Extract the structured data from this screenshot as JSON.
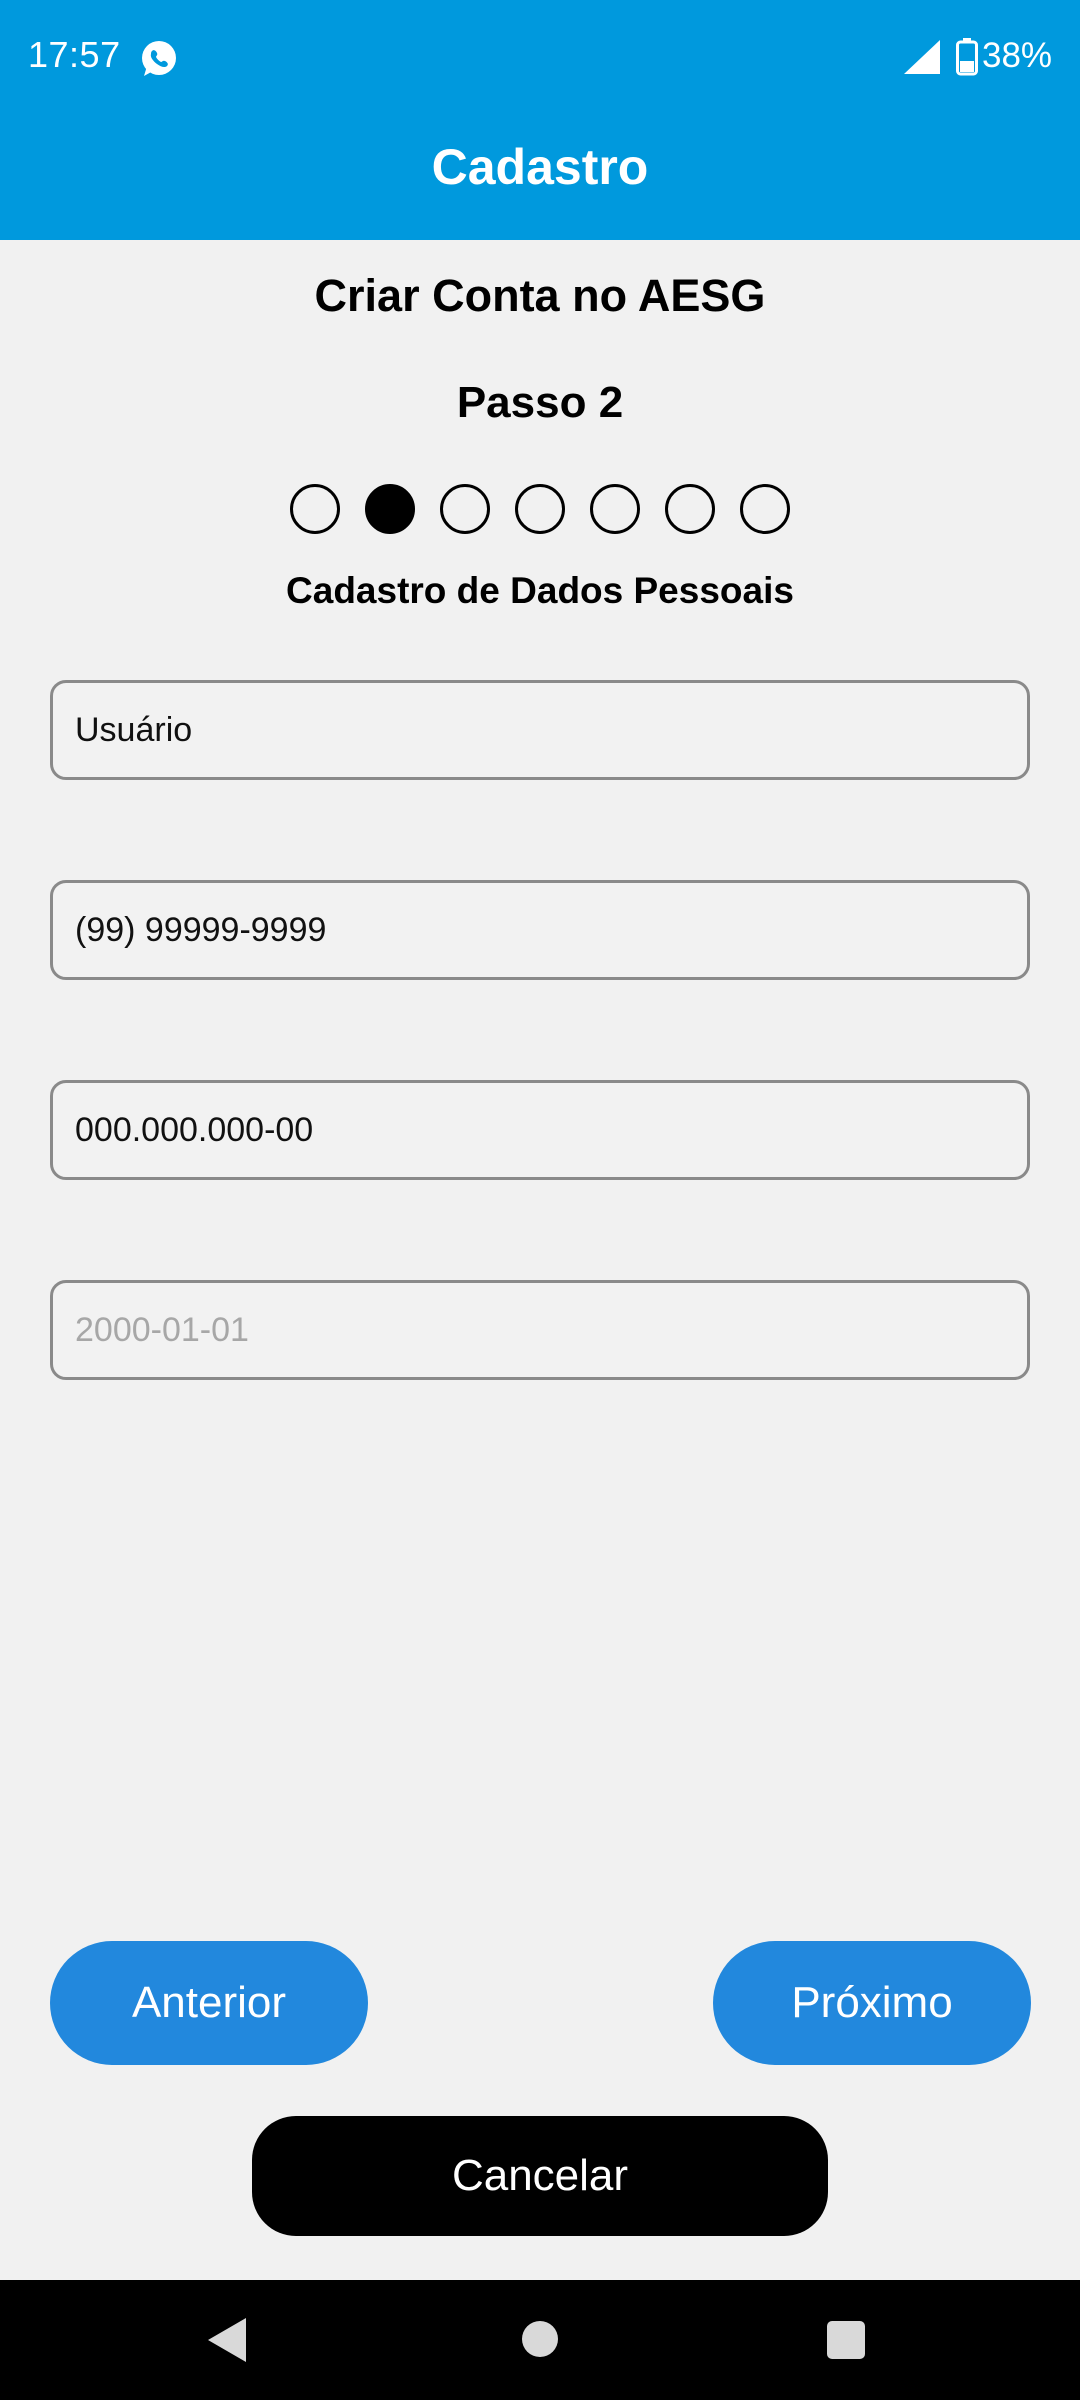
{
  "status_bar": {
    "time": "17:57",
    "notification_icon": "whatsapp-icon",
    "signal_icon": "cell-signal-icon",
    "battery_icon": "battery-icon",
    "battery_percent": "38%"
  },
  "app_bar": {
    "title": "Cadastro"
  },
  "page": {
    "title": "Criar Conta no AESG",
    "step_label": "Passo 2",
    "section_title": "Cadastro de Dados Pessoais"
  },
  "stepper": {
    "total_steps": 7,
    "current_step": 2
  },
  "form": {
    "fields": [
      {
        "name": "username",
        "value": "Usuário",
        "placeholder": ""
      },
      {
        "name": "phone",
        "value": "(99) 99999-9999",
        "placeholder": ""
      },
      {
        "name": "cpf",
        "value": "000.000.000-00",
        "placeholder": ""
      },
      {
        "name": "birthdate",
        "value": "",
        "placeholder": "2000-01-01"
      }
    ]
  },
  "buttons": {
    "previous": "Anterior",
    "next": "Próximo",
    "cancel": "Cancelar"
  },
  "colors": {
    "header": "#0099dd",
    "primary_button": "#2288dd",
    "cancel_button": "#000000",
    "background": "#f1f1f1"
  },
  "nav_bar": {
    "back_icon": "back-triangle-icon",
    "home_icon": "home-circle-icon",
    "recents_icon": "recents-square-icon"
  }
}
